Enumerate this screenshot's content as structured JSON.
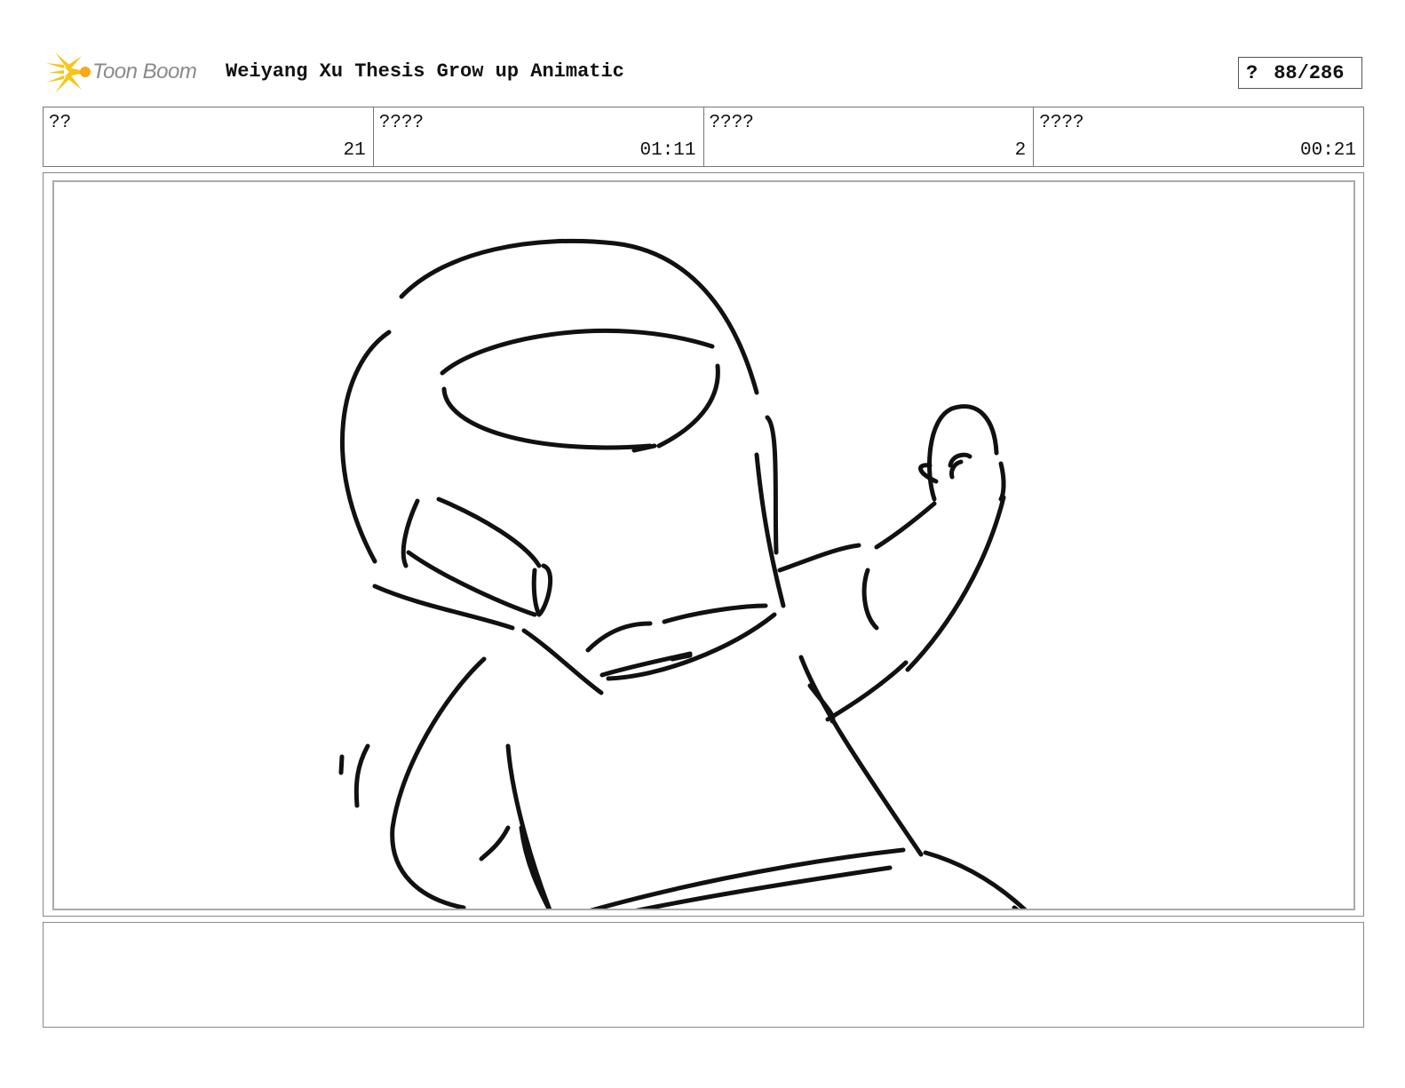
{
  "header": {
    "logo_text": "Toon Boom",
    "title": "Weiyang Xu Thesis Grow up Animatic",
    "page_marker": "?",
    "page_number": "88/286"
  },
  "info": {
    "cells": [
      {
        "label": "??",
        "value": "21"
      },
      {
        "label": "????",
        "value": "01:11"
      },
      {
        "label": "????",
        "value": "2"
      },
      {
        "label": "????",
        "value": "00:21"
      }
    ]
  },
  "panel": {
    "sketch_icon": "astronaut-sketch"
  },
  "notes": {
    "text": ""
  },
  "colors": {
    "logo_yellow": "#f5c518",
    "logo_text": "#8a8a8a",
    "ink": "#111111"
  }
}
